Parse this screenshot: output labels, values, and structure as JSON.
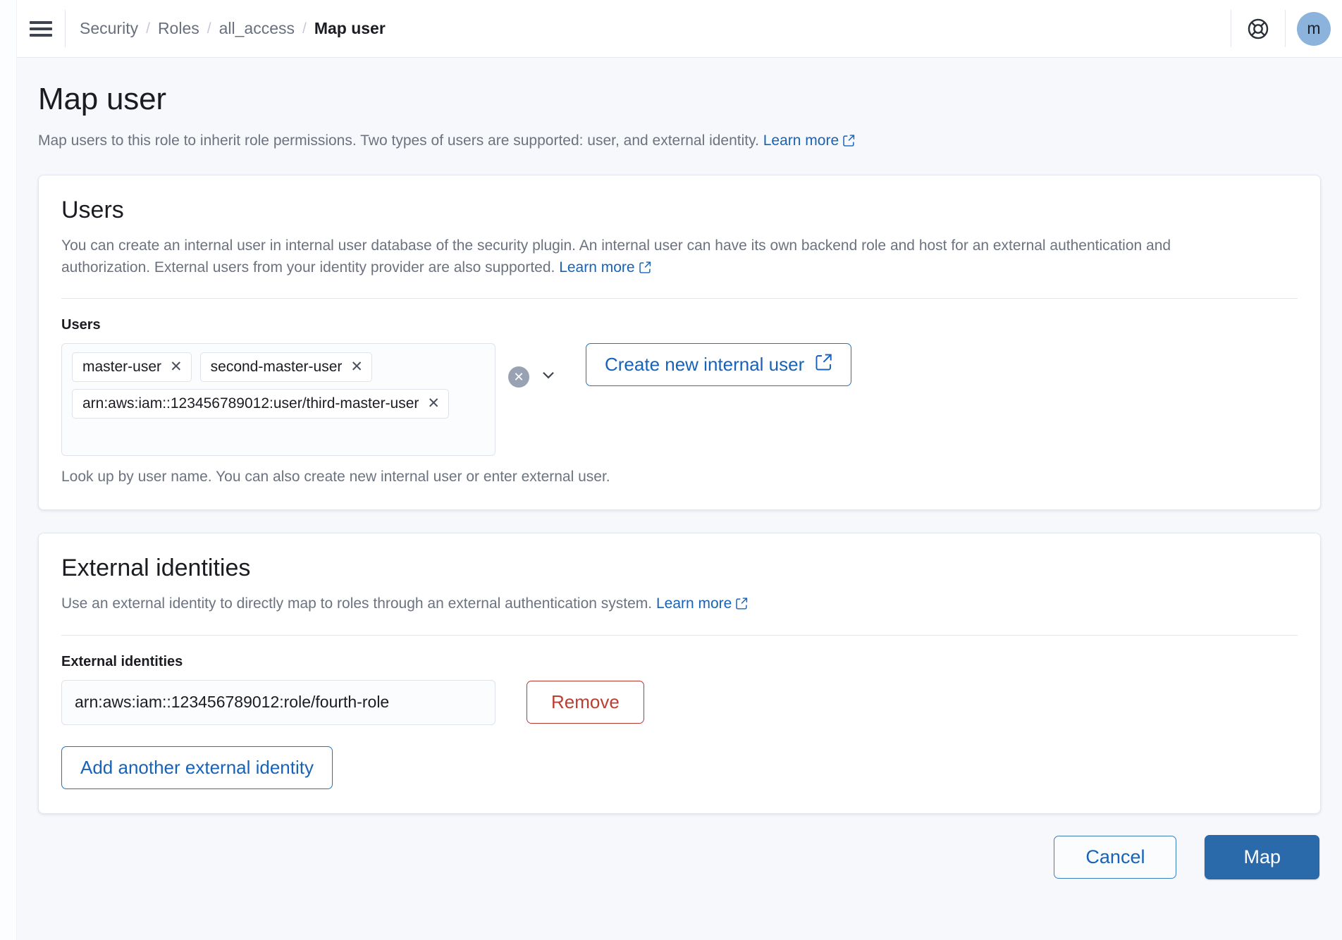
{
  "header": {
    "menu_icon": "hamburger-icon",
    "help_icon": "lifebuoy-icon",
    "breadcrumb": [
      {
        "label": "Security",
        "current": false
      },
      {
        "label": "Roles",
        "current": false
      },
      {
        "label": "all_access",
        "current": false
      },
      {
        "label": "Map user",
        "current": true
      }
    ],
    "breadcrumb_separator": "/",
    "avatar_initial": "m",
    "avatar_color": "#8bb3db"
  },
  "page": {
    "title": "Map user",
    "description": "Map users to this role to inherit role permissions. Two types of users are supported: user, and external identity.",
    "learn_more": "Learn more"
  },
  "users_card": {
    "title": "Users",
    "description": "You can create an internal user in internal user database of the security plugin. An internal user can have its own backend role and host for an external authentication and authorization. External users from your identity provider are also supported.",
    "learn_more": "Learn more",
    "field_label": "Users",
    "pills": [
      "master-user",
      "second-master-user",
      "arn:aws:iam::123456789012:user/third-master-user"
    ],
    "pill_remove_glyph": "✕",
    "clear_all_glyph": "✕",
    "create_button": "Create new internal user",
    "helper_text": "Look up by user name. You can also create new internal user or enter external user."
  },
  "external_card": {
    "title": "External identities",
    "description": "Use an external identity to directly map to roles through an external authentication system.",
    "learn_more": "Learn more",
    "field_label": "External identities",
    "identity_value": "arn:aws:iam::123456789012:role/fourth-role",
    "identity_placeholder": "",
    "remove_button": "Remove",
    "add_button": "Add another external identity"
  },
  "footer": {
    "cancel": "Cancel",
    "map": "Map",
    "primary_color": "#2a6aab"
  }
}
